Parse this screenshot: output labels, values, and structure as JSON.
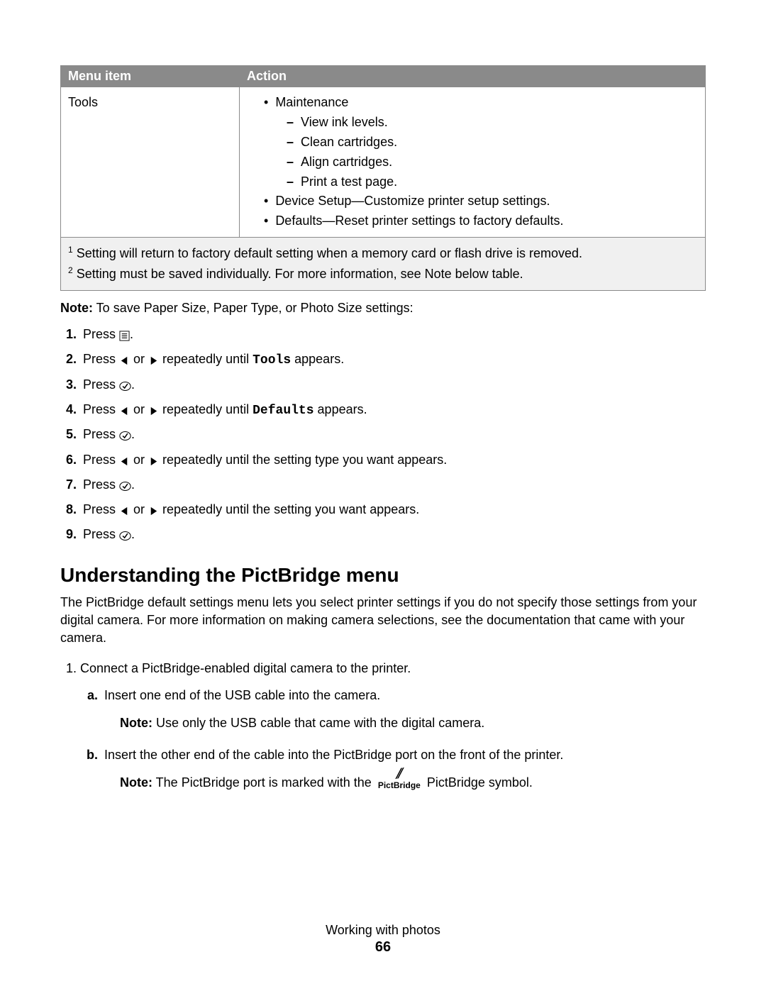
{
  "table": {
    "headers": [
      "Menu item",
      "Action"
    ],
    "row": {
      "menu_item": "Tools",
      "actions": {
        "maintenance_label": "Maintenance",
        "maintenance_sub": [
          "View ink levels.",
          "Clean cartridges.",
          "Align cartridges.",
          "Print a test page."
        ],
        "device_setup": "Device Setup—Customize printer setup settings.",
        "defaults": "Defaults—Reset printer settings to factory defaults."
      }
    },
    "footnotes": [
      "Setting will return to factory default setting when a memory card or flash drive is removed.",
      "Setting must be saved individually. For more information, see Note below table."
    ]
  },
  "note_intro": {
    "bold": "Note:",
    "text": " To save Paper Size, Paper Type, or Photo Size settings:"
  },
  "steps": {
    "s1a": "Press ",
    "s1b": ".",
    "s2a": "Press ",
    "s2b": " or ",
    "s2c": " repeatedly until ",
    "s2d": "Tools",
    "s2e": " appears.",
    "s3a": "Press ",
    "s3b": ".",
    "s4a": "Press ",
    "s4b": " or ",
    "s4c": " repeatedly until ",
    "s4d": "Defaults",
    "s4e": " appears.",
    "s5a": "Press ",
    "s5b": ".",
    "s6a": "Press ",
    "s6b": " or ",
    "s6c": " repeatedly until the setting type you want appears.",
    "s7a": "Press ",
    "s7b": ".",
    "s8a": "Press ",
    "s8b": " or ",
    "s8c": " repeatedly until the setting you want appears.",
    "s9a": "Press ",
    "s9b": "."
  },
  "heading": "Understanding the PictBridge menu",
  "intro_para": "The PictBridge default settings menu lets you select printer settings if you do not specify those settings from your digital camera. For more information on making camera selections, see the documentation that came with your camera.",
  "pict_steps": {
    "p1": "Connect a PictBridge-enabled digital camera to the printer.",
    "a": "Insert one end of the USB cable into the camera.",
    "a_note_bold": "Note:",
    "a_note": " Use only the USB cable that came with the digital camera.",
    "b": "Insert the other end of the cable into the PictBridge port on the front of the printer.",
    "b_note_bold": "Note:",
    "b_note_before": " The PictBridge port is marked with the ",
    "b_note_after": " PictBridge symbol."
  },
  "pictbridge_word": "PictBridge",
  "footer": {
    "section": "Working with photos",
    "page": "66"
  }
}
